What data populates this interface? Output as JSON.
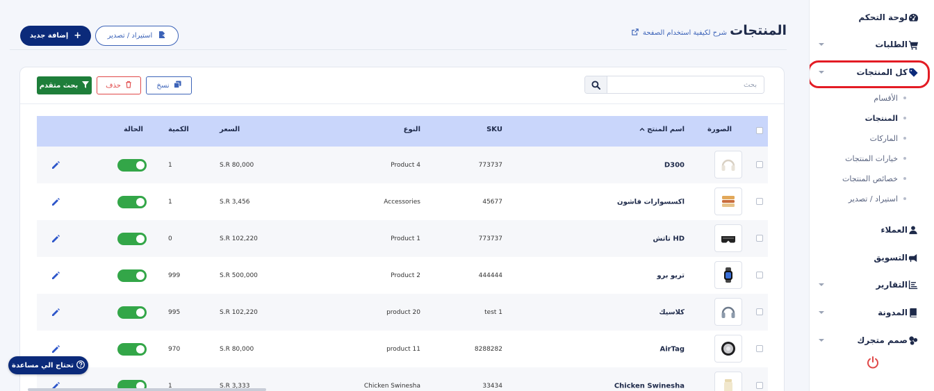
{
  "sidebar": {
    "items": [
      {
        "label": "لوحة التحكم",
        "icon": "gauge-icon",
        "has_chevron": false
      },
      {
        "label": "الطلبات",
        "icon": "cart-icon",
        "has_chevron": true
      },
      {
        "label": "كل المنتجات",
        "icon": "tag-icon",
        "has_chevron": true,
        "active": true
      },
      {
        "label": "العملاء",
        "icon": "user-icon",
        "has_chevron": false
      },
      {
        "label": "التسويق",
        "icon": "megaphone-icon",
        "has_chevron": false
      },
      {
        "label": "التقارير",
        "icon": "chart-icon",
        "has_chevron": true
      },
      {
        "label": "المدونة",
        "icon": "book-icon",
        "has_chevron": true
      },
      {
        "label": "صمم متجرك",
        "icon": "palette-icon",
        "has_chevron": true
      }
    ],
    "sub_items": [
      {
        "label": "الأقسام"
      },
      {
        "label": "المنتجات",
        "current": true
      },
      {
        "label": "الماركات"
      },
      {
        "label": "خيارات المنتجات"
      },
      {
        "label": "خصائص المنتجات"
      },
      {
        "label": "استيراد / تصدير"
      }
    ],
    "logout_icon": "power-icon"
  },
  "header": {
    "title": "المنتجات",
    "help_link": "شرح لكيفية استخدام الصفحة",
    "add_button": "إضافة جديد",
    "import_export_button": "استيراد / تصدير"
  },
  "toolbar": {
    "search_placeholder": "بحث",
    "advanced_search": "بحث متقدم",
    "delete": "حذف",
    "copy": "نسخ"
  },
  "table": {
    "headers": {
      "image": "الصورة",
      "name": "اسم المنتج",
      "sku": "SKU",
      "type": "النوع",
      "price": "السعر",
      "quantity": "الكمية",
      "status": "الحالة"
    },
    "rows": [
      {
        "name": "D300",
        "sku": "773737",
        "type": "Product 4",
        "price": "S.R 80,000",
        "qty": "1",
        "thumb": "headphones-icon"
      },
      {
        "name": "اكسسوارات فاشون",
        "sku": "45677",
        "type": "Accessories",
        "price": "S.R 3,456",
        "qty": "1",
        "thumb": "food-icon"
      },
      {
        "name": "تاتش HD",
        "sku": "773737",
        "type": "Product 1",
        "price": "S.R 102,220",
        "qty": "0",
        "thumb": "vr-headset-icon"
      },
      {
        "name": "تريو برو",
        "sku": "444444",
        "type": "Product 2",
        "price": "S.R 500,000",
        "qty": "999",
        "thumb": "watch-icon"
      },
      {
        "name": "كلاسيك",
        "sku": "test 1",
        "type": "product 20",
        "price": "S.R 102,220",
        "qty": "995",
        "thumb": "headphones-icon"
      },
      {
        "name": "AirTag",
        "sku": "8288282",
        "type": "product 11",
        "price": "S.R 80,000",
        "qty": "970",
        "thumb": "airtag-icon"
      },
      {
        "name": "Chicken Swinesha",
        "sku": "33434",
        "type": "Chicken Swinesha",
        "price": "S.R 3,333",
        "qty": "1",
        "thumb": "jar-icon"
      }
    ]
  },
  "help_pill": "تحتاج الي مساعدة",
  "colors": {
    "primary": "#0b2a7a",
    "green": "#33a648",
    "danger": "#e04848",
    "link": "#3c63b8",
    "table_header": "#c9d6fb",
    "highlight": "#e31c24"
  }
}
